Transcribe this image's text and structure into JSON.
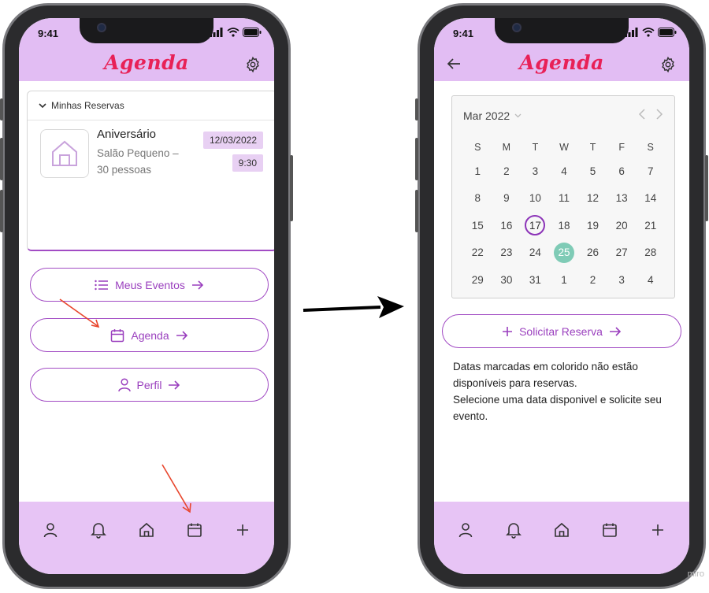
{
  "status_bar": {
    "time": "9:41"
  },
  "left_screen": {
    "header": {
      "title": "Agenda"
    },
    "reservations_card": {
      "heading": "Minhas Reservas",
      "event": {
        "title": "Aniversário",
        "subtitle": "Salão Pequeno – 30 pessoas",
        "date": "12/03/2022",
        "time": "9:30"
      }
    },
    "buttons": {
      "meus_eventos": "Meus Eventos",
      "agenda": "Agenda",
      "perfil": "Perfil"
    },
    "tabbar": [
      "user-icon",
      "bell-icon",
      "home-icon",
      "calendar-icon",
      "plus-icon"
    ]
  },
  "right_screen": {
    "header": {
      "title": "Agenda"
    },
    "calendar": {
      "month_label": "Mar 2022",
      "weekdays": [
        "S",
        "M",
        "T",
        "W",
        "T",
        "F",
        "S"
      ],
      "weeks": [
        [
          "1",
          "2",
          "3",
          "4",
          "5",
          "6",
          "7"
        ],
        [
          "8",
          "9",
          "10",
          "11",
          "12",
          "13",
          "14"
        ],
        [
          "15",
          "16",
          "17",
          "18",
          "19",
          "20",
          "21"
        ],
        [
          "22",
          "23",
          "24",
          "25",
          "26",
          "27",
          "28"
        ],
        [
          "29",
          "30",
          "31",
          "1",
          "2",
          "3",
          "4"
        ]
      ],
      "today": "17",
      "marked_unavailable": "25"
    },
    "request_button": "Solicitar Reserva",
    "info_text_1": "Datas marcadas em colorido não estão disponíveis para reservas.",
    "info_text_2": "Selecione uma data disponivel e solicite seu evento."
  },
  "colors": {
    "header_bg": "#e2bdf3",
    "tabbar_bg": "#e7c4f5",
    "title": "#e82157",
    "accent": "#a24cc4",
    "marked_date": "#7fcbb6",
    "annotation_arrow": "#e8452c"
  },
  "watermark": "miro"
}
